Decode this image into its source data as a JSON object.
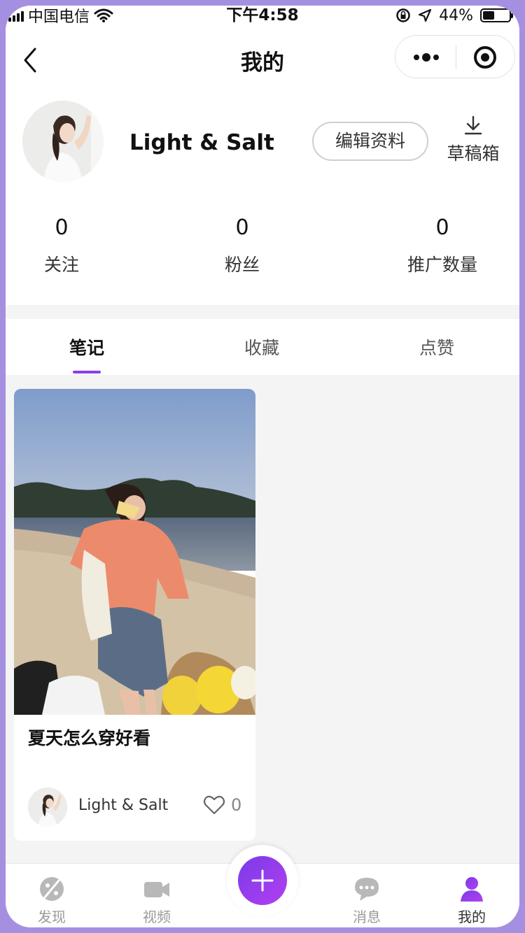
{
  "status_bar": {
    "carrier": "中国电信",
    "time": "下午4:58",
    "battery_text": "44%",
    "battery_level": 0.44
  },
  "nav": {
    "title": "我的"
  },
  "profile": {
    "username": "Light & Salt",
    "edit_label": "编辑资料",
    "drafts_label": "草稿箱",
    "stats": [
      {
        "value": "0",
        "label": "关注"
      },
      {
        "value": "0",
        "label": "粉丝"
      },
      {
        "value": "0",
        "label": "推广数量"
      }
    ]
  },
  "tabs": [
    {
      "label": "笔记",
      "active": true
    },
    {
      "label": "收藏",
      "active": false
    },
    {
      "label": "点赞",
      "active": false
    }
  ],
  "notes": [
    {
      "title": "夏天怎么穿好看",
      "author": "Light & Salt",
      "likes": "0"
    }
  ],
  "tabbar": {
    "items": [
      {
        "label": "发现",
        "icon": "discover-icon"
      },
      {
        "label": "视频",
        "icon": "video-icon"
      },
      {
        "label": "消息",
        "icon": "message-icon"
      },
      {
        "label": "我的",
        "icon": "profile-icon",
        "active": true
      }
    ],
    "fab_icon": "plus-icon"
  },
  "colors": {
    "accent": "#8b3fe6",
    "frame": "#a58fe0",
    "background": "#f4f4f4"
  }
}
